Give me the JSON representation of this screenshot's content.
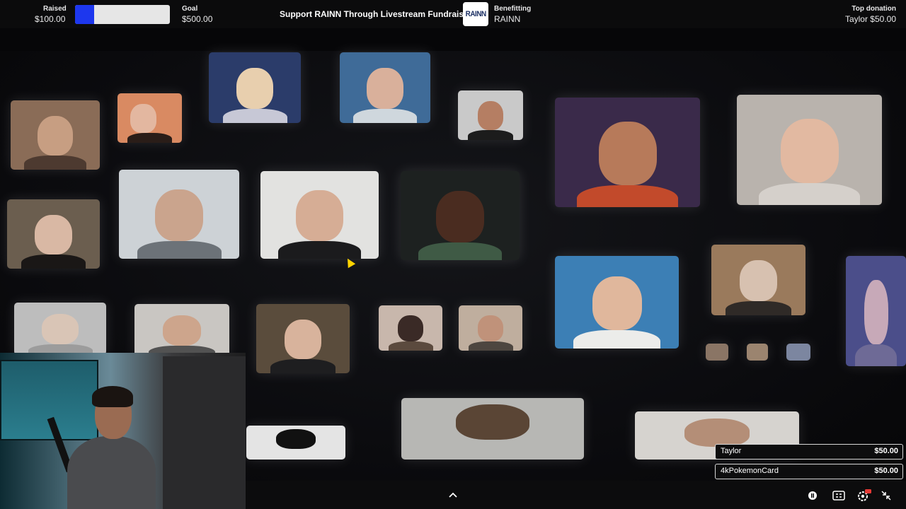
{
  "stream_bar": {
    "raised_label": "Raised",
    "raised_value": "$100.00",
    "goal_label": "Goal",
    "goal_value": "$500.00",
    "progress_fraction": 0.2,
    "progress_color": "#1d37ee",
    "title": "Support RAINN Through Livestream Fundraising",
    "logo_text": "RAINN",
    "benefitting_label": "Benefitting",
    "benefitting_value": "RAINN",
    "top_donation_label": "Top donation",
    "top_donation_value": "Taylor $50.00"
  },
  "donations": [
    {
      "name": "Taylor",
      "amount": "$50.00"
    },
    {
      "name": "4kPokemonCard",
      "amount": "$50.00"
    }
  ],
  "controls": {
    "expand_icon": "chevron-up-icon",
    "pause_icon": "pause-icon",
    "captions_icon": "cc-icon",
    "settings_icon": "gear-icon",
    "settings_badge": "4K",
    "exit_fullscreen_icon": "minimize-icon"
  }
}
